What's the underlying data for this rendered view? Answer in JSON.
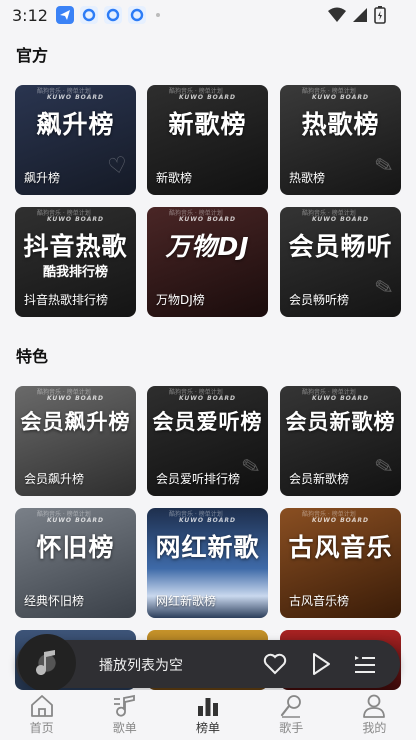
{
  "status_bar": {
    "time": "3:12"
  },
  "sections": [
    {
      "title": "官方"
    },
    {
      "title": "特色"
    }
  ],
  "brand": {
    "en": "KUWO BOARD",
    "cn": "酷狗音乐 · 榜单计划"
  },
  "official_cards": [
    {
      "big": "飙升榜",
      "sub": "",
      "name": "飙升榜",
      "accent": "#1f2a44"
    },
    {
      "big": "新歌榜",
      "sub": "",
      "name": "新歌榜",
      "accent": "#2b2b2b"
    },
    {
      "big": "热歌榜",
      "sub": "",
      "name": "热歌榜",
      "accent": "#333333"
    },
    {
      "big": "抖音热歌",
      "sub": "酷我排行榜",
      "name": "抖音热歌排行榜",
      "accent": "#2a2a2a"
    },
    {
      "big": "万物DJ",
      "sub": "",
      "name": "万物DJ榜",
      "accent": "#3a2020"
    },
    {
      "big": "会员畅听",
      "sub": "",
      "name": "会员畅听榜",
      "accent": "#2c2c2c"
    }
  ],
  "special_cards": [
    {
      "big": "会员飙升榜",
      "sub": "",
      "name": "会员飙升榜",
      "accent": "#555555"
    },
    {
      "big": "会员爱听榜",
      "sub": "",
      "name": "会员爱听排行榜",
      "accent": "#2a2a2a"
    },
    {
      "big": "会员新歌榜",
      "sub": "",
      "name": "会员新歌榜",
      "accent": "#303030"
    },
    {
      "big": "怀旧榜",
      "sub": "",
      "name": "经典怀旧榜",
      "accent": "#5a6068"
    },
    {
      "big": "网红新歌",
      "sub": "",
      "name": "网红新歌榜",
      "accent": "#2d4a73"
    },
    {
      "big": "古风音乐",
      "sub": "",
      "name": "古风音乐榜",
      "accent": "#6b3b18"
    }
  ],
  "player": {
    "label": "播放列表为空"
  },
  "tabs": [
    {
      "label": "首页",
      "icon": "home-icon"
    },
    {
      "label": "歌单",
      "icon": "music-note-icon"
    },
    {
      "label": "榜单",
      "icon": "chart-icon"
    },
    {
      "label": "歌手",
      "icon": "singer-icon"
    },
    {
      "label": "我的",
      "icon": "profile-icon"
    }
  ],
  "colors": {
    "background": "#f5f5f7",
    "player_bg": "#2f2f33",
    "active_tab": "#333333",
    "inactive_tab": "#888888"
  }
}
